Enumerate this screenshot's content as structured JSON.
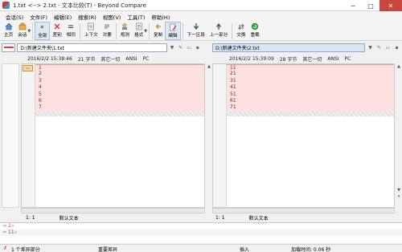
{
  "window": {
    "title": "1.txt <--> 2.txt - 文本比较(T) - Beyond Compare",
    "min": "─",
    "max": "□",
    "close": "✕"
  },
  "menu": [
    "会话(S)",
    "文件(F)",
    "编辑(E)",
    "搜索(R)",
    "视图(V)",
    "工具(T)",
    "帮助(H)"
  ],
  "toolbar": {
    "home": "主页",
    "session": "会话",
    "all": "全部",
    "diffs": "差别",
    "same": "相同",
    "context": "上下文",
    "minor": "次要",
    "rules": "规则",
    "format": "格式",
    "copy": "复制",
    "edit": "编辑",
    "next_section": "下一区段",
    "prev_section": "上一部分",
    "swap": "交换",
    "reload": "重载"
  },
  "left": {
    "path": "D:\\新建文件夹\\1.txt",
    "date": "2016/2/2 15:38:46",
    "size": "21 字节",
    "other": "其它一切",
    "encoding": "ANSI",
    "lineend": "PC",
    "lines": [
      "1",
      "2",
      "3",
      "4",
      "5",
      "6",
      "7"
    ],
    "position": "1: 1",
    "default_text": "默认文本"
  },
  "right": {
    "path": "D:\\新建文件夹\\2.txt",
    "date": "2016/2/2 15:39:09",
    "size": "28 字节",
    "other": "其它一切",
    "encoding": "ANSI",
    "lineend": "PC",
    "lines": [
      "11",
      "21",
      "31",
      "41",
      "51",
      "61",
      "71"
    ],
    "position": "1: 1",
    "default_text": "默认文本"
  },
  "bottom": {
    "line1_marker": "⇒",
    "line1_text": "1",
    "line1_end": "¤",
    "line2_marker": "⇒",
    "line2_text": "11",
    "line2_end": "¤"
  },
  "status": {
    "diff_count": "1 个差异部分",
    "important": "重要差异",
    "insert": "插入",
    "load_time": "加载时间: 0.06 秒"
  }
}
